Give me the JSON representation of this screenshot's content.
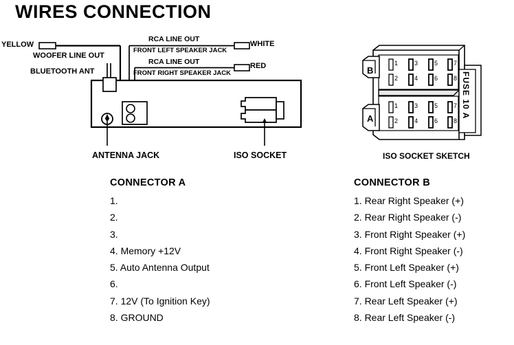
{
  "title": "WIRES CONNECTION",
  "wiring_diagram": {
    "wire_labels": {
      "yellow": "YELLOW",
      "white": "WHITE",
      "red": "RED",
      "woofer_line_out": "WOOFER LINE OUT",
      "bluetooth_ant": "BLUETOOTH ANT",
      "rca_line_out_left": "RCA LINE OUT",
      "front_left_speaker_jack": "FRONT LEFT SPEAKER JACK",
      "rca_line_out_right": "RCA LINE OUT",
      "front_right_speaker_jack": "FRONT RIGHT SPEAKER JACK"
    },
    "callouts": {
      "antenna_jack": "ANTENNA JACK",
      "iso_socket": "ISO SOCKET"
    }
  },
  "iso_socket_sketch": {
    "caption": "ISO SOCKET SKETCH",
    "block_top_label": "B",
    "block_bottom_label": "A",
    "fuse_label": "FUSE 10 A",
    "pin_numbers_row_top": [
      "1",
      "3",
      "5",
      "7"
    ],
    "pin_numbers_row_bottom": [
      "2",
      "4",
      "6",
      "8"
    ]
  },
  "connector_a": {
    "heading": "CONNECTOR A",
    "items": [
      "1.",
      "2.",
      "3.",
      "4. Memory +12V",
      "5. Auto Antenna Output",
      "6.",
      "7. 12V (To Ignition Key)",
      "8. GROUND"
    ]
  },
  "connector_b": {
    "heading": "CONNECTOR B",
    "items": [
      "1. Rear Right Speaker (+)",
      "2. Rear Right Speaker (-)",
      "3. Front Right Speaker (+)",
      "4. Front Right Speaker (-)",
      "5. Front Left Speaker (+)",
      "6. Front Left Speaker (-)",
      "7. Rear Left Speaker (+)",
      "8. Rear Left Speaker (-)"
    ]
  },
  "colors": {
    "line": "#000000",
    "fill": "#ffffff",
    "sketch_shade": "#e8e8e8"
  }
}
